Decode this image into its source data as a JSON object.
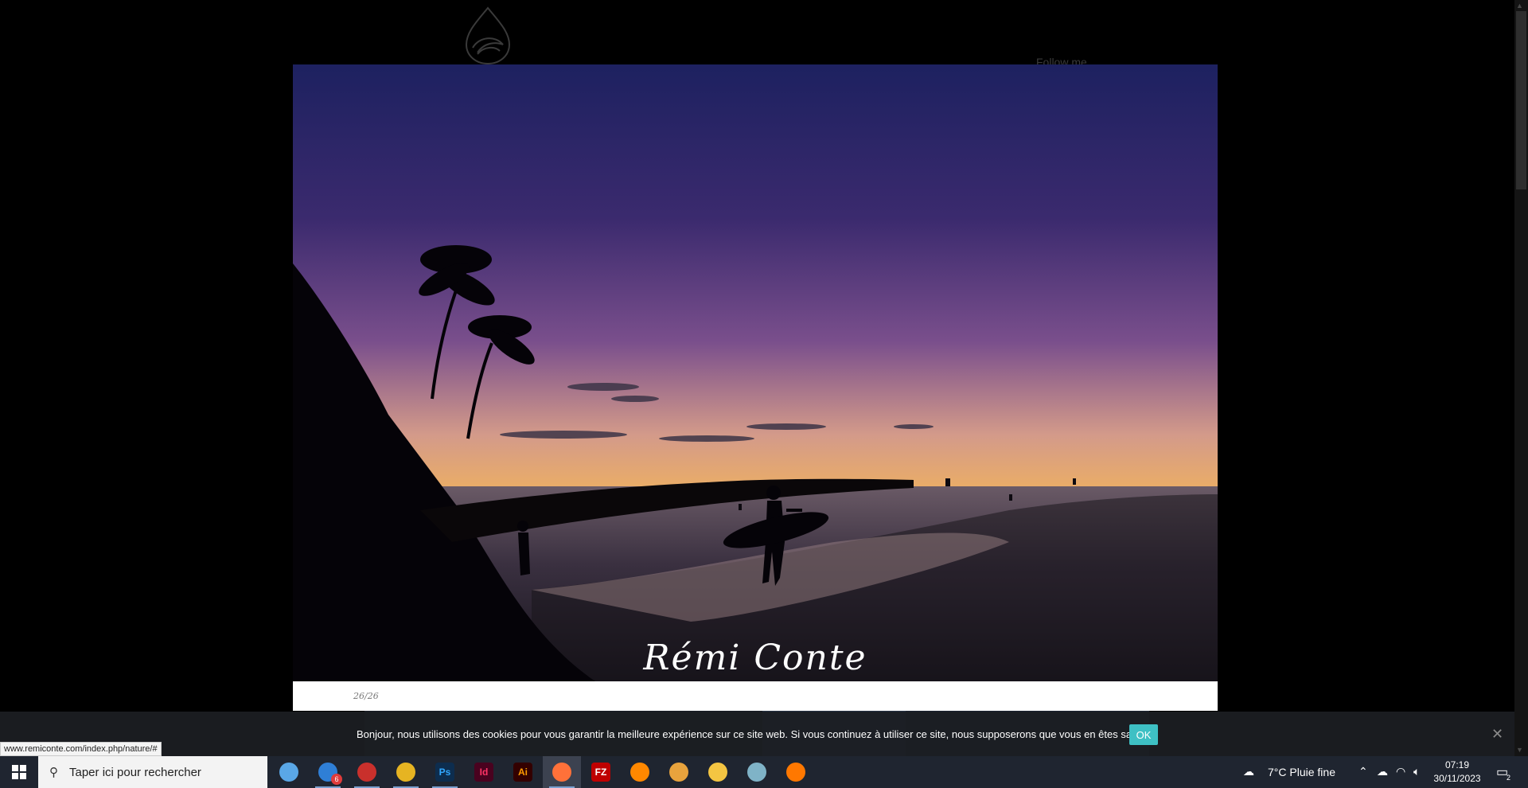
{
  "site": {
    "follow_label": "Follow me"
  },
  "lightbox": {
    "counter": "26/26",
    "watermark": "Rémi Conte"
  },
  "cookie": {
    "message": "Bonjour, nous utilisons des cookies pour vous garantir la meilleure expérience sur ce site web. Si vous continuez à utiliser ce site, nous supposerons que vous en êtes satisfait.",
    "ok_label": "OK",
    "close_glyph": "✕"
  },
  "status_url": "www.remiconte.com/index.php/nature/#",
  "taskbar": {
    "search_placeholder": "Taper ici pour rechercher",
    "apps": [
      {
        "name": "laptop",
        "label": "",
        "color": "#5aa7e6",
        "active": false,
        "running": false
      },
      {
        "name": "messenger",
        "label": "",
        "color": "#2f7fd6",
        "active": false,
        "running": true,
        "badge": "6"
      },
      {
        "name": "red-app",
        "label": "",
        "color": "#c9302c",
        "active": false,
        "running": true
      },
      {
        "name": "chrome",
        "label": "",
        "color": "#e6b422",
        "active": false,
        "running": true
      },
      {
        "name": "photoshop",
        "label": "Ps",
        "color": "#0d2d4e",
        "text_color": "#31a8ff",
        "active": false,
        "running": true
      },
      {
        "name": "indesign",
        "label": "Id",
        "color": "#49021f",
        "text_color": "#ff3366",
        "active": false,
        "running": false
      },
      {
        "name": "illustrator",
        "label": "Ai",
        "color": "#330000",
        "text_color": "#ff9a00",
        "active": false,
        "running": false
      },
      {
        "name": "firefox",
        "label": "",
        "color": "#ff7139",
        "active": true,
        "running": true
      },
      {
        "name": "filezilla",
        "label": "FZ",
        "color": "#bf0000",
        "text_color": "#ffffff",
        "active": false,
        "running": false
      },
      {
        "name": "vlc",
        "label": "",
        "color": "#ff8800",
        "active": false,
        "running": false
      },
      {
        "name": "vpn",
        "label": "",
        "color": "#e8a33d",
        "active": false,
        "running": false
      },
      {
        "name": "file-explorer",
        "label": "",
        "color": "#f4c542",
        "active": false,
        "running": false
      },
      {
        "name": "notes",
        "label": "",
        "color": "#7fb3c7",
        "active": false,
        "running": false
      },
      {
        "name": "avast",
        "label": "",
        "color": "#ff7800",
        "active": false,
        "running": false
      }
    ],
    "weather": "7°C  Pluie fine",
    "time": "07:19",
    "date": "30/11/2023",
    "notification_count": "2"
  }
}
